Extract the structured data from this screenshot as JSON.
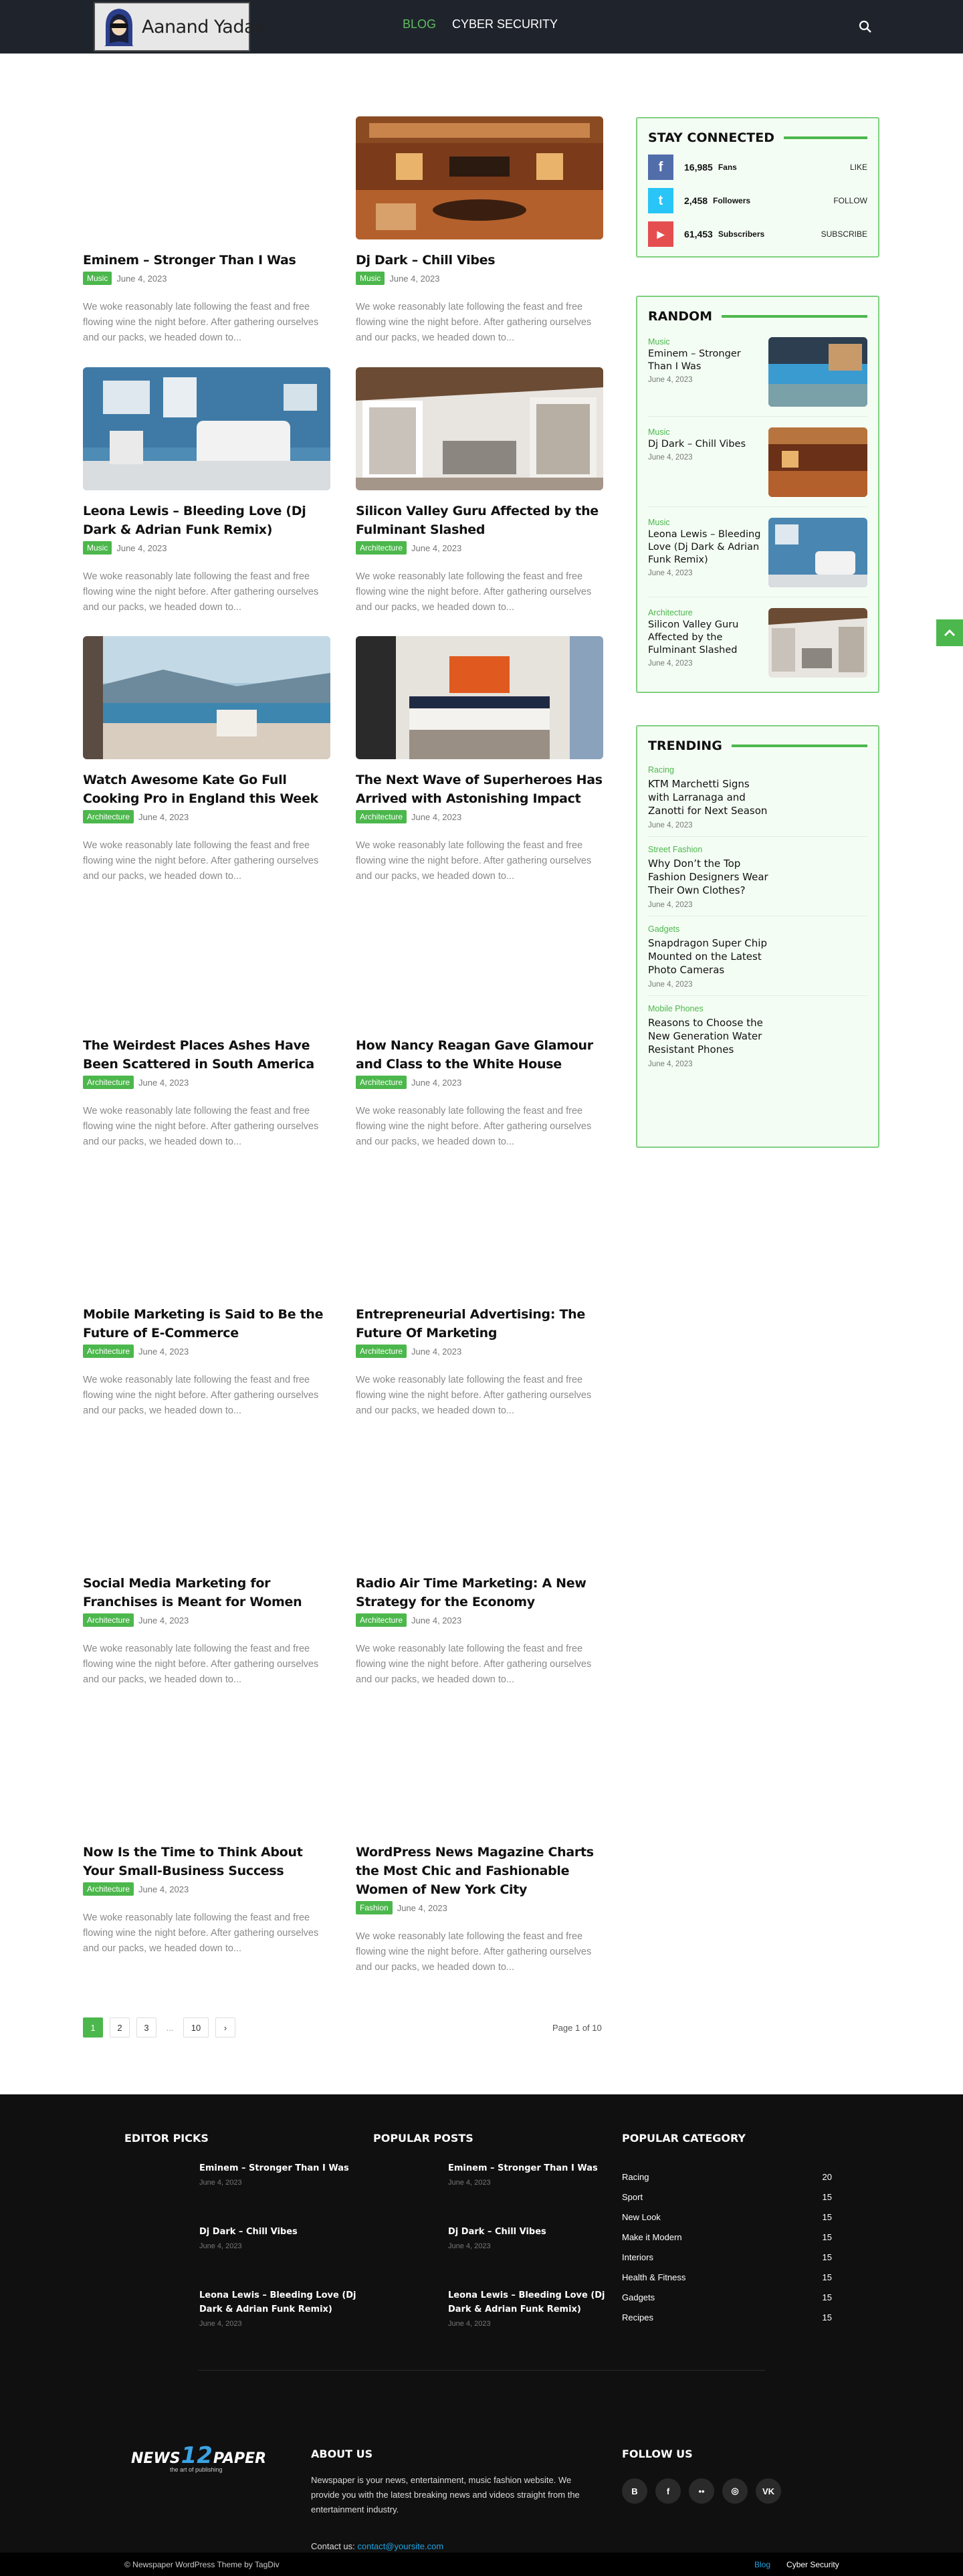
{
  "header": {
    "logo_text": "Aanand Yadav",
    "nav": [
      {
        "label": "BLOG",
        "active": true
      },
      {
        "label": "CYBER SECURITY",
        "active": false
      }
    ]
  },
  "excerpt": "We woke reasonably late following the feast and free flowing wine the night before. After gathering ourselves and our packs, we headed down to...",
  "posts": [
    {
      "title": "Eminem – Stronger Than I Was",
      "category": "Music",
      "date": "June 4, 2023"
    },
    {
      "title": "Dj Dark – Chill Vibes",
      "category": "Music",
      "date": "June 4, 2023"
    },
    {
      "title": "Leona Lewis – Bleeding Love (Dj Dark & Adrian Funk Remix)",
      "category": "Music",
      "date": "June 4, 2023"
    },
    {
      "title": "Silicon Valley Guru Affected by the Fulminant Slashed",
      "category": "Architecture",
      "date": "June 4, 2023"
    },
    {
      "title": "Watch Awesome Kate Go Full Cooking Pro in England this Week",
      "category": "Architecture",
      "date": "June 4, 2023"
    },
    {
      "title": "The Next Wave of Superheroes Has Arrived with Astonishing Impact",
      "category": "Architecture",
      "date": "June 4, 2023"
    },
    {
      "title": "The Weirdest Places Ashes Have Been Scattered in South America",
      "category": "Architecture",
      "date": "June 4, 2023"
    },
    {
      "title": "How Nancy Reagan Gave Glamour and Class to the White House",
      "category": "Architecture",
      "date": "June 4, 2023"
    },
    {
      "title": "Mobile Marketing is Said to Be the Future of E-Commerce",
      "category": "Architecture",
      "date": "June 4, 2023"
    },
    {
      "title": "Entrepreneurial Advertising: The Future Of Marketing",
      "category": "Architecture",
      "date": "June 4, 2023"
    },
    {
      "title": "Social Media Marketing for Franchises is Meant for Women",
      "category": "Architecture",
      "date": "June 4, 2023"
    },
    {
      "title": "Radio Air Time Marketing: A New Strategy for the Economy",
      "category": "Architecture",
      "date": "June 4, 2023"
    },
    {
      "title": "Now Is the Time to Think About Your Small-Business Success",
      "category": "Architecture",
      "date": "June 4, 2023"
    },
    {
      "title": "WordPress News Magazine Charts the Most Chic and Fashionable Women of New York City",
      "category": "Fashion",
      "date": "June 4, 2023"
    }
  ],
  "pagination": {
    "pages": [
      "1",
      "2",
      "3",
      "...",
      "10"
    ],
    "next": "›",
    "page_of": "Page 1 of 10"
  },
  "sidebar": {
    "stay_connected": {
      "title": "STAY CONNECTED",
      "rows": [
        {
          "icon": "facebook-icon",
          "icon_glyph": "f",
          "count": "16,985",
          "label": "Fans",
          "action": "LIKE",
          "color": "#516eab"
        },
        {
          "icon": "twitter-icon",
          "icon_glyph": "t",
          "count": "2,458",
          "label": "Followers",
          "action": "FOLLOW",
          "color": "#29c5f6"
        },
        {
          "icon": "youtube-icon",
          "icon_glyph": "▶",
          "count": "61,453",
          "label": "Subscribers",
          "action": "SUBSCRIBE",
          "color": "#e44e4f"
        }
      ]
    },
    "random": {
      "title": "RANDOM",
      "items": [
        {
          "category": "Music",
          "title": "Eminem – Stronger Than I Was",
          "date": "June 4, 2023"
        },
        {
          "category": "Music",
          "title": "Dj Dark – Chill Vibes",
          "date": "June 4, 2023"
        },
        {
          "category": "Music",
          "title": "Leona Lewis – Bleeding Love (Dj Dark & Adrian Funk Remix)",
          "date": "June 4, 2023"
        },
        {
          "category": "Architecture",
          "title": "Silicon Valley Guru Affected by the Fulminant Slashed",
          "date": "June 4, 2023"
        }
      ]
    },
    "trending": {
      "title": "TRENDING",
      "items": [
        {
          "category": "Racing",
          "title": "KTM Marchetti Signs with Larranaga and Zanotti for Next Season",
          "date": "June 4, 2023"
        },
        {
          "category": "Street Fashion",
          "title": "Why Don’t the Top Fashion Designers Wear Their Own Clothes?",
          "date": "June 4, 2023"
        },
        {
          "category": "Gadgets",
          "title": "Snapdragon Super Chip Mounted on the Latest Photo Cameras",
          "date": "June 4, 2023"
        },
        {
          "category": "Mobile Phones",
          "title": "Reasons to Choose the New Generation Water Resistant Phones",
          "date": "June 4, 2023"
        }
      ]
    }
  },
  "footer": {
    "editor_picks": {
      "title": "EDITOR PICKS",
      "items": [
        {
          "title": "Eminem – Stronger Than I Was",
          "date": "June 4, 2023"
        },
        {
          "title": "Dj Dark – Chill Vibes",
          "date": "June 4, 2023"
        },
        {
          "title": "Leona Lewis – Bleeding Love (Dj Dark & Adrian Funk Remix)",
          "date": "June 4, 2023"
        }
      ]
    },
    "popular_posts": {
      "title": "POPULAR POSTS",
      "items": [
        {
          "title": "Eminem – Stronger Than I Was",
          "date": "June 4, 2023"
        },
        {
          "title": "Dj Dark – Chill Vibes",
          "date": "June 4, 2023"
        },
        {
          "title": "Leona Lewis – Bleeding Love (Dj Dark & Adrian Funk Remix)",
          "date": "June 4, 2023"
        }
      ]
    },
    "popular_category": {
      "title": "POPULAR CATEGORY",
      "items": [
        {
          "name": "Racing",
          "count": "20"
        },
        {
          "name": "Sport",
          "count": "15"
        },
        {
          "name": "New Look",
          "count": "15"
        },
        {
          "name": "Make it Modern",
          "count": "15"
        },
        {
          "name": "Interiors",
          "count": "15"
        },
        {
          "name": "Health & Fitness",
          "count": "15"
        },
        {
          "name": "Gadgets",
          "count": "15"
        },
        {
          "name": "Recipes",
          "count": "15"
        }
      ]
    },
    "logo": {
      "word_left": "NEWS",
      "number": "12",
      "word_right": "PAPER",
      "tagline": "the art of publishing"
    },
    "about": {
      "title": "ABOUT US",
      "text": "Newspaper is your news, entertainment, music fashion website. We provide you with the latest breaking news and videos straight from the entertainment industry.",
      "contact_label": "Contact us:",
      "contact_email": "contact@yoursite.com"
    },
    "follow": {
      "title": "FOLLOW US",
      "icons": [
        {
          "name": "behance-icon",
          "glyph": "B"
        },
        {
          "name": "facebook-icon",
          "glyph": "f"
        },
        {
          "name": "flickr-icon",
          "glyph": "••"
        },
        {
          "name": "instagram-icon",
          "glyph": "◎"
        },
        {
          "name": "vk-icon",
          "glyph": "VK"
        }
      ]
    },
    "copyright": "© Newspaper WordPress Theme by TagDiv",
    "bottom_links": [
      {
        "label": "Blog",
        "active": true
      },
      {
        "label": "Cyber Security",
        "active": false
      }
    ]
  },
  "colors": {
    "accent": "#4cb74c",
    "header_bg": "#1f242c",
    "footer_bg": "#101010",
    "link_blue": "#1fa3e0"
  }
}
